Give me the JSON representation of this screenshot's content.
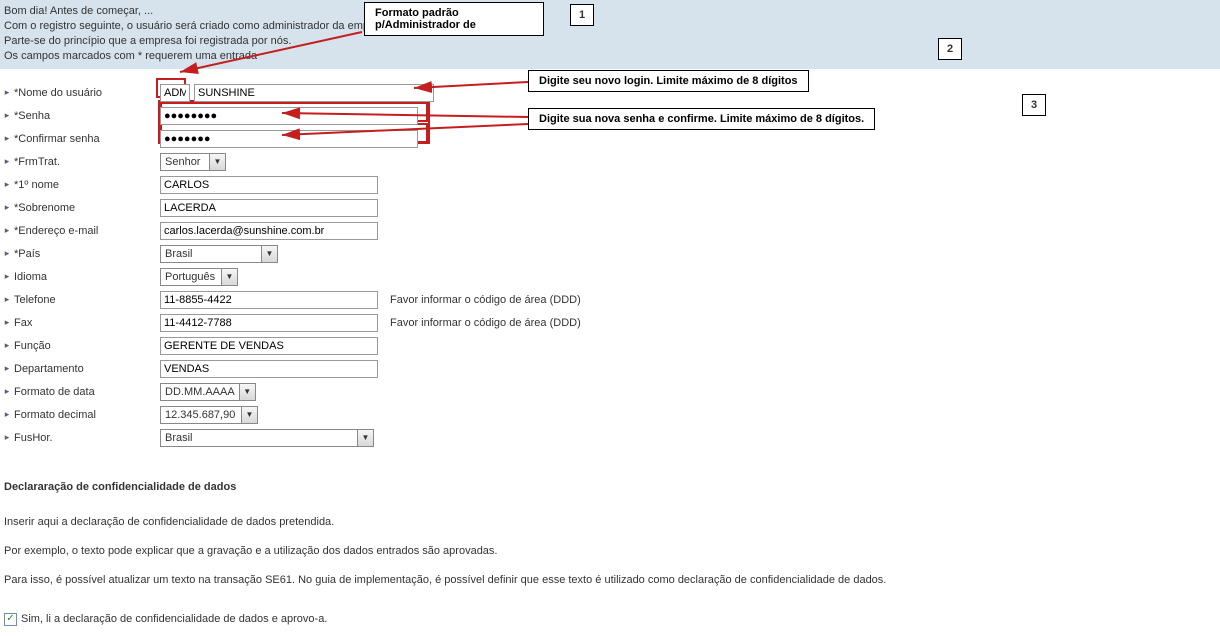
{
  "header": {
    "line1": "Bom dia! Antes de começar, ...",
    "line2": "Com o registro seguinte, o usuário será criado como administrador da emp",
    "line3": "Parte-se do princípio que a empresa foi registrada por nós.",
    "line4": "Os campos marcados com * requerem uma entrada"
  },
  "labels": {
    "username": "*Nome do usuário",
    "password": "*Senha",
    "confirm": "*Confirmar senha",
    "frmtrat": "*FrmTrat.",
    "firstname": "*1º nome",
    "lastname": "*Sobrenome",
    "email": "*Endereço e-mail",
    "country": "*País",
    "language": "Idioma",
    "phone": "Telefone",
    "fax": "Fax",
    "function": "Função",
    "department": "Departamento",
    "dateformat": "Formato de data",
    "decimalformat": "Formato decimal",
    "timezone": "FusHor."
  },
  "values": {
    "username_prefix": "ADM_",
    "username": "SUNSHINE",
    "password": "●●●●●●●●",
    "confirm": "●●●●●●●",
    "frmtrat": "Senhor",
    "firstname": "CARLOS",
    "lastname": "LACERDA",
    "email": "carlos.lacerda@sunshine.com.br",
    "country": "Brasil",
    "language": "Português",
    "phone": "11-8855-4422",
    "fax": "11-4412-7788",
    "function": "GERENTE DE VENDAS",
    "department": "VENDAS",
    "dateformat": "DD.MM.AAAA",
    "decimalformat": "12.345.687,90",
    "timezone": "Brasil"
  },
  "hints": {
    "ddd": "Favor informar o código de área (DDD)"
  },
  "callouts": {
    "n1": "1",
    "n2": "2",
    "n3": "3",
    "c1": "Formato padrão p/Administrador de",
    "c2": "Digite seu novo login. Limite máximo de 8 dígitos",
    "c3": "Digite sua nova senha e confirme. Limite máximo de 8 dígitos."
  },
  "declaration": {
    "title": "Declararação de confidencialidade de dados",
    "p1": "Inserir aqui a declaração de confidencialidade de dados pretendida.",
    "p2": "Por exemplo, o texto pode explicar que a gravação e a utilização dos dados entrados são aprovadas.",
    "p3": "Para isso, é possível atualizar um texto na transação SE61. No guia de implementação, é possível definir que esse texto é utilizado como declaração de confidencialidade de dados.",
    "accept": "Sim, li a declaração de confidencialidade de dados e aprovo-a."
  }
}
